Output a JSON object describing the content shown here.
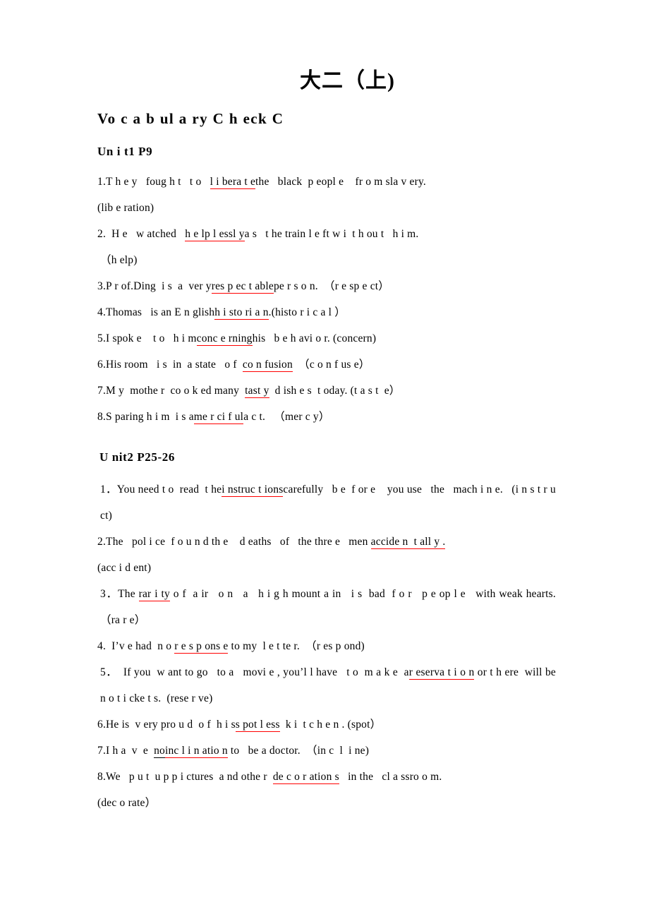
{
  "document": {
    "title": "大二（上)",
    "section_title": "Vo c a b ul a ry C h eck C"
  },
  "units": [
    {
      "heading": "Un i t1 P9",
      "items": [
        {
          "number": "1.",
          "before": "T h e y   foug h t   t o   ",
          "answer": "l i bera t e",
          "after": "the   black  p eopl e    fr o m sla v ery.",
          "cue": "(lib e ration)"
        },
        {
          "number": "2.",
          "before": "  H e   w atched   ",
          "answer": "h e lp l essl y",
          "after": "a s   t he train l e ft w i  t h ou t   h i m.",
          "cue": "（h elp)"
        },
        {
          "number": "3.",
          "before": "P r of.Ding  i s  a  ver y",
          "answer": "res p ec t able",
          "after": "pe r s o n.  （r e sp e ct）",
          "cue": ""
        },
        {
          "number": "4.",
          "before": "Thomas   is an E n glish",
          "answer": "h i sto ri a n",
          "after": ".(histo r i c a l ）",
          "cue": ""
        },
        {
          "number": "5.",
          "before": "I spok e    t o   h i m",
          "answer": "conc e rning",
          "after": "his   b e h avi o r. (concern)",
          "cue": ""
        },
        {
          "number": "6.",
          "before": "His room   i s  in  a state   o f  ",
          "answer": "co n fusion",
          "after": "  （c o n f us e）",
          "cue": ""
        },
        {
          "number": "7.",
          "before": "M y  mothe r  co o k ed many  ",
          "answer": "tast y",
          "after": "  d ish e s  t oday. (t a s t  e）",
          "cue": ""
        },
        {
          "number": "8.",
          "before": "S paring h i m  i s a",
          "answer": "me r ci f ul",
          "after": "a c t.   （mer c y）",
          "cue": ""
        }
      ]
    },
    {
      "heading": "U nit2   P25-26",
      "items": [
        {
          "number": "1．",
          "before": "You need t o  read  t he",
          "answer": "i nstruc t ions",
          "after": "carefully   b e  f or e    you use   the   mach i n e.   (i n s t r u ct)",
          "cue": ""
        },
        {
          "number": "2.",
          "before": "The   pol i ce  f o u n d th e    d eaths   of   the thre e   men ",
          "answer": "accide n  t all y .",
          "after": "",
          "cue": "(acc i  d ent)"
        },
        {
          "number": "3．",
          "before": "The ",
          "answer": "rar i ty",
          "after": " o f  a ir   o n   a   h i g h mount a in   i s  bad  f o r   p e op l e   with weak hearts.    （ra r e）",
          "cue": ""
        },
        {
          "number": "4.",
          "before": "  I’v e had  n o ",
          "answer": "r e s p ons e",
          "after": " to my  l e t te r.  （r es p ond)",
          "cue": ""
        },
        {
          "number": "5．",
          "before": "  If you  w ant to go   to a   movi e , you’l l have   t o  m a k e  a",
          "answer": "r eserva t i o n",
          "after": " or t h ere  will be  n o t i cke t s.  (rese r ve)",
          "cue": ""
        },
        {
          "number": "6.",
          "before": "He is  v ery pro u d  o f  h i s",
          "answer": "s pot l ess",
          "after": "  k i  t c h e n . (spot）",
          "cue": ""
        },
        {
          "number": "7.",
          "before": "I h a  v  e  ",
          "answer_black": "no",
          "answer": "inc l i n atio n",
          "after": " to   be a doctor.  （in c  l  i ne)",
          "cue": ""
        },
        {
          "number": "8.",
          "before": "We   p u t  u p p i ctures  a nd othe r  ",
          "answer": "de c o r ation s",
          "after": "   in the   cl a ssro o m.",
          "cue": "(dec o rate）"
        }
      ]
    }
  ],
  "colors": {
    "answer_underline": "#ff0000",
    "text": "#000000",
    "background": "#ffffff"
  }
}
